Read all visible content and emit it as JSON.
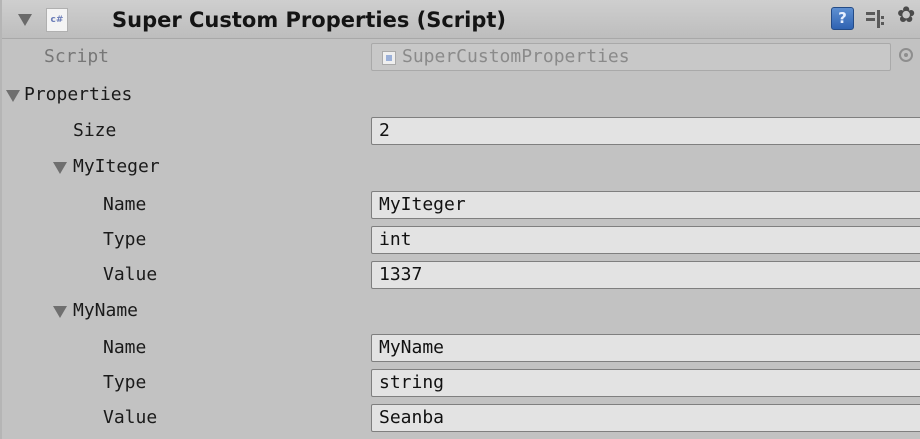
{
  "component": {
    "title": "Super Custom Properties (Script)",
    "icon_text": "c#",
    "help_icon_text": "?"
  },
  "script_row": {
    "label": "Script",
    "value": "SuperCustomProperties"
  },
  "properties": {
    "label": "Properties",
    "size_label": "Size",
    "size_value": "2",
    "items": [
      {
        "header": "MyIteger",
        "name_label": "Name",
        "name_value": "MyIteger",
        "type_label": "Type",
        "type_value": "int",
        "value_label": "Value",
        "value_value": "1337"
      },
      {
        "header": "MyName",
        "name_label": "Name",
        "name_value": "MyName",
        "type_label": "Type",
        "type_value": "string",
        "value_label": "Value",
        "value_value": "Seanba"
      }
    ]
  },
  "icons": {
    "foldout": "triangle-down-icon",
    "script": "csharp-script-icon",
    "help": "help-icon",
    "presets": "presets-icon",
    "settings": "gear-icon",
    "object_picker": "object-picker-icon"
  },
  "colors": {
    "background": "#c2c2c2",
    "field_background": "#e3e3e3",
    "help_blue": "#3f73c0"
  }
}
